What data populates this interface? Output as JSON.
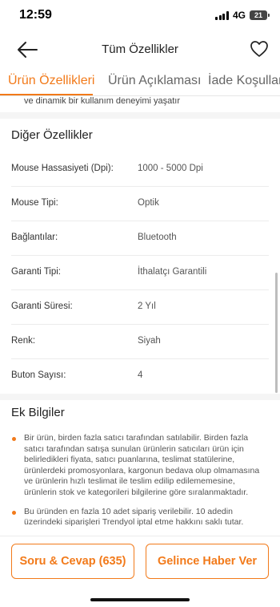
{
  "status_bar": {
    "time": "12:59",
    "network": "4G",
    "battery": "21"
  },
  "nav": {
    "title": "Tüm Özellikler"
  },
  "tabs": [
    {
      "label": "Ürün Özellikleri",
      "active": true
    },
    {
      "label": "Ürün Açıklaması",
      "active": false
    },
    {
      "label": "İade Koşulları",
      "active": false
    }
  ],
  "fade_text": "ve dinamik bir kullanım deneyimi yaşatır",
  "other_features": {
    "title": "Diğer Özellikler",
    "rows": [
      {
        "label": "Mouse Hassasiyeti (Dpi):",
        "value": "1000 - 5000 Dpi"
      },
      {
        "label": "Mouse Tipi:",
        "value": "Optik"
      },
      {
        "label": "Bağlantılar:",
        "value": "Bluetooth"
      },
      {
        "label": "Garanti Tipi:",
        "value": "İthalatçı Garantili"
      },
      {
        "label": "Garanti Süresi:",
        "value": "2 Yıl"
      },
      {
        "label": "Renk:",
        "value": "Siyah"
      },
      {
        "label": "Buton Sayısı:",
        "value": "4"
      }
    ]
  },
  "extra_info": {
    "title": "Ek Bilgiler",
    "bullets": [
      "Bir ürün, birden fazla satıcı tarafından satılabilir. Birden fazla satıcı tarafından satışa sunulan ürünlerin satıcıları ürün için belirledikleri fiyata, satıcı puanlarına, teslimat statülerine, ürünlerdeki promosyonlara, kargonun bedava olup olmamasına ve ürünlerin hızlı teslimat ile teslim edilip edilememesine, ürünlerin stok ve kategorileri bilgilerine göre sıralanmaktadır.",
      "Bu üründen en fazla 10 adet sipariş verilebilir. 10 adedin üzerindeki siparişleri Trendyol iptal etme hakkını saklı tutar."
    ]
  },
  "bottom": {
    "qa_button": "Soru & Cevap (635)",
    "notify_button": "Gelince Haber Ver"
  },
  "colors": {
    "accent": "#f27a1a",
    "divider": "#f5f5f5"
  }
}
